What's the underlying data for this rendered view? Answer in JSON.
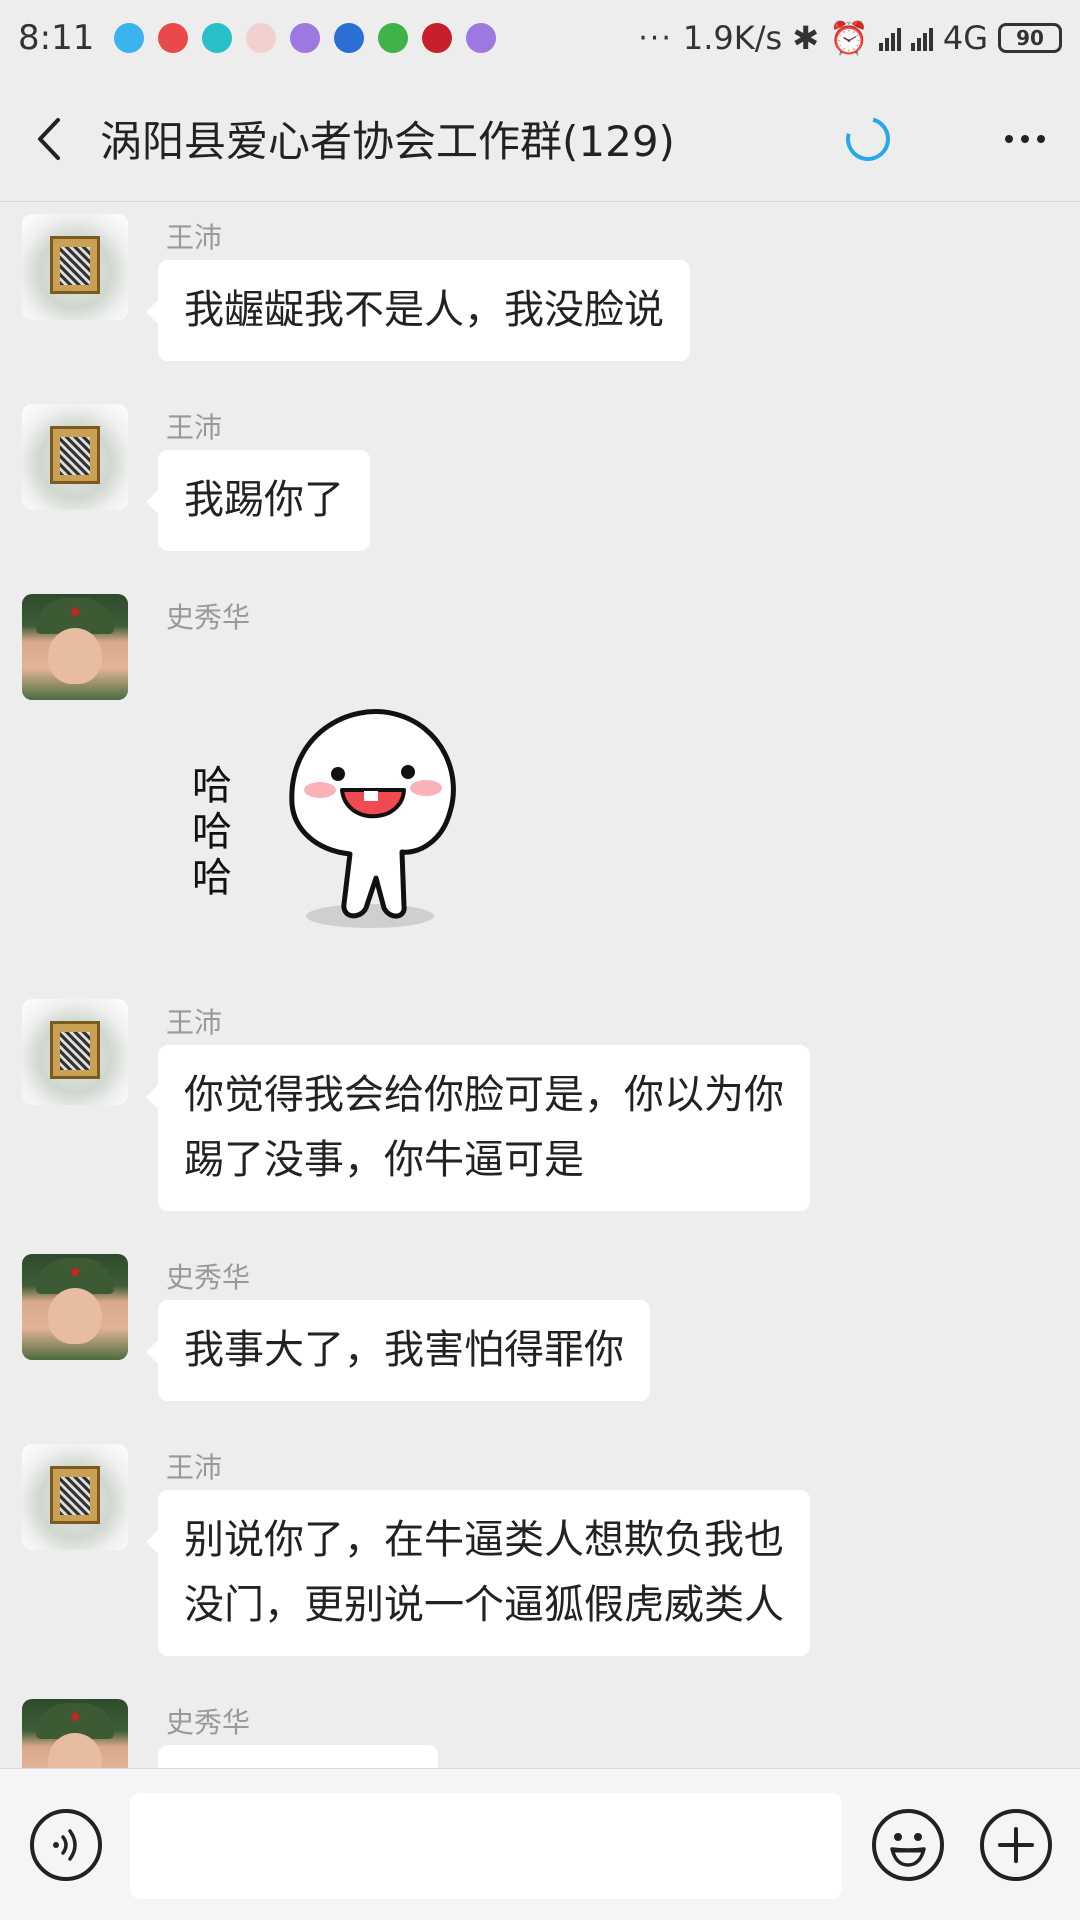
{
  "status_bar": {
    "time": "8:11",
    "more_indicator": "···",
    "net_speed": "1.9K/s",
    "network": "4G",
    "battery": "90"
  },
  "header": {
    "title": "涡阳县爱心者协会工作群(129)"
  },
  "messages": [
    {
      "sender": "王沛",
      "text": "我龌龊我不是人，我没脸说",
      "avatar": "wangpei"
    },
    {
      "sender": "王沛",
      "text": "我踢你了",
      "avatar": "wangpei"
    },
    {
      "sender": "史秀华",
      "sticker_text": "哈哈哈",
      "avatar": "shixiuhua"
    },
    {
      "sender": "王沛",
      "text_line1": "你觉得我会给你脸可是，你以为你",
      "text_line2": "踢了没事，你牛逼可是",
      "avatar": "wangpei"
    },
    {
      "sender": "史秀华",
      "text": "我事大了，我害怕得罪你",
      "avatar": "shixiuhua"
    },
    {
      "sender": "王沛",
      "text_line1": "别说你了，在牛逼类人想欺负我也",
      "text_line2": "没门，更别说一个逼狐假虎威类人",
      "avatar": "wangpei"
    },
    {
      "sender": "史秀华",
      "text": "",
      "avatar": "shixiuhua"
    }
  ],
  "input_bar": {
    "placeholder": ""
  },
  "icons": {
    "back": "back-arrow-icon",
    "loading": "loading-spinner-icon",
    "more": "more-icon",
    "voice": "voice-icon",
    "emoji": "emoji-icon",
    "plus": "plus-icon"
  },
  "colors": {
    "background": "#ededed",
    "bubble": "#ffffff",
    "spinner": "#29a8e8",
    "sender_name": "#999999"
  }
}
